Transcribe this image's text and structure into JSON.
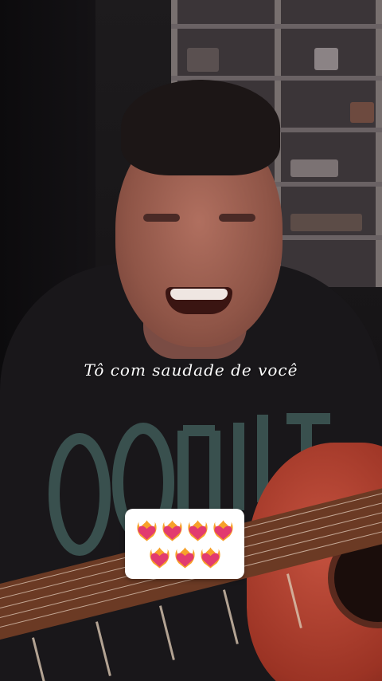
{
  "video": {
    "caption": "Tô com saudade de você"
  },
  "sticker": {
    "emoji_rows": [
      [
        "heart-on-fire-icon",
        "heart-on-fire-icon",
        "heart-on-fire-icon",
        "heart-on-fire-icon"
      ],
      [
        "heart-on-fire-icon",
        "heart-on-fire-icon",
        "heart-on-fire-icon"
      ]
    ],
    "background": "#ffffff"
  },
  "colors": {
    "caption_text": "#ffffff",
    "heart_fill": "#e23b6f",
    "flame": "#f7a12a"
  }
}
